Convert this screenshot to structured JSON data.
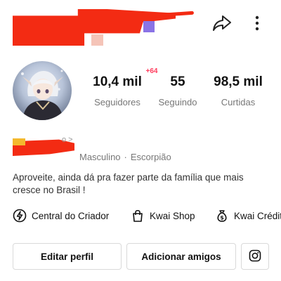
{
  "header": {
    "share_icon": "share-arrow-icon",
    "more_icon": "vertical-dots-icon",
    "redaction_color": "#f32b13"
  },
  "profile": {
    "badge": "+64",
    "stats": [
      {
        "value": "10,4 mil",
        "label": "Seguidores"
      },
      {
        "value": "55",
        "label": "Seguindo"
      },
      {
        "value": "98,5 mil",
        "label": "Curtidas"
      }
    ],
    "info_fragment": "o >",
    "gender": "Masculino",
    "separator": "·",
    "zodiac": "Escorpião",
    "bio": "Aproveite, ainda dá pra fazer parte da família que mais cresce no Brasil !"
  },
  "links": [
    {
      "label": "Central do Criador",
      "icon": "lightning-icon"
    },
    {
      "label": "Kwai Shop",
      "icon": "shopping-bag-icon"
    },
    {
      "label": "Kwai Crédit",
      "icon": "money-bag-icon"
    }
  ],
  "buttons": {
    "edit": "Editar perfil",
    "add_friends": "Adicionar amigos",
    "instagram_icon": "instagram-icon"
  },
  "colors": {
    "badge": "#ff3b5c",
    "secondary_text": "#777777"
  }
}
